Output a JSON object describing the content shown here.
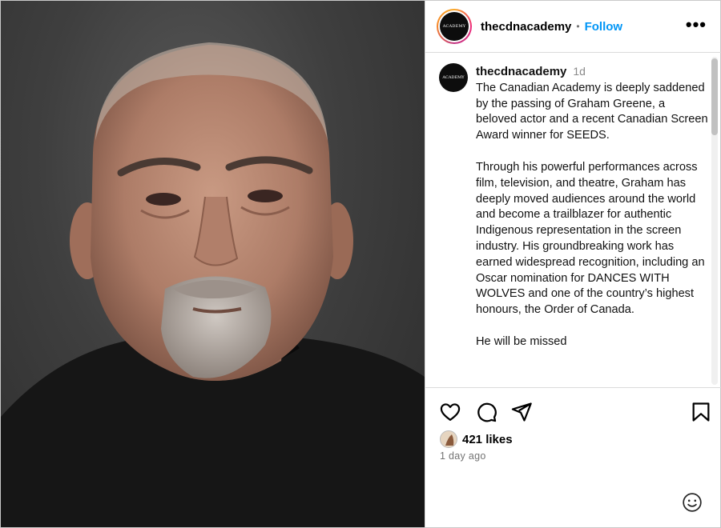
{
  "header": {
    "username": "thecdnacademy",
    "separator": "•",
    "follow_label": "Follow",
    "more_label": "•••",
    "avatar_text": "ACADEMY"
  },
  "caption": {
    "username": "thecdnacademy",
    "time": "1d",
    "paragraph1": "The Canadian Academy is deeply saddened by the passing of Graham Greene, a beloved actor and a recent Canadian Screen Award winner for SEEDS.",
    "paragraph2": "Through his powerful performances across film, television, and theatre, Graham has deeply moved audiences around the world and become a trailblazer for authentic Indigenous representation in the screen industry. His groundbreaking work has earned widespread recognition, including an Oscar nomination for DANCES WITH WOLVES and one of the country’s highest honours, the Order of Canada.",
    "paragraph3_partial": "He will be missed"
  },
  "icons": {
    "like": "heart-icon",
    "comment": "comment-icon",
    "share": "send-icon",
    "save": "bookmark-icon",
    "emoji": "emoji-icon"
  },
  "likes": {
    "count_text": "421 likes"
  },
  "post_age": "1 day ago",
  "colors": {
    "follow": "#0095f6",
    "border": "#dbdbdb",
    "muted": "#737373"
  }
}
